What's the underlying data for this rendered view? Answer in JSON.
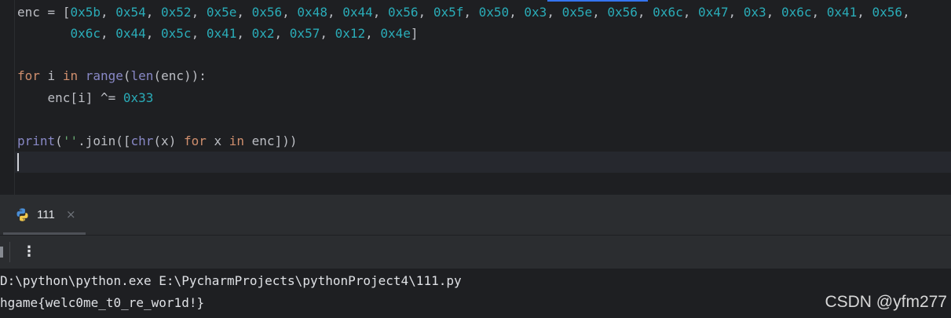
{
  "editor": {
    "lines": [
      [
        {
          "t": "enc = [",
          "c": "ident"
        },
        {
          "t": "0x5b",
          "c": "num"
        },
        {
          "t": ", ",
          "c": "ident"
        },
        {
          "t": "0x54",
          "c": "num"
        },
        {
          "t": ", ",
          "c": "ident"
        },
        {
          "t": "0x52",
          "c": "num"
        },
        {
          "t": ", ",
          "c": "ident"
        },
        {
          "t": "0x5e",
          "c": "num"
        },
        {
          "t": ", ",
          "c": "ident"
        },
        {
          "t": "0x56",
          "c": "num"
        },
        {
          "t": ", ",
          "c": "ident"
        },
        {
          "t": "0x48",
          "c": "num"
        },
        {
          "t": ", ",
          "c": "ident"
        },
        {
          "t": "0x44",
          "c": "num"
        },
        {
          "t": ", ",
          "c": "ident"
        },
        {
          "t": "0x56",
          "c": "num"
        },
        {
          "t": ", ",
          "c": "ident"
        },
        {
          "t": "0x5f",
          "c": "num"
        },
        {
          "t": ", ",
          "c": "ident"
        },
        {
          "t": "0x50",
          "c": "num"
        },
        {
          "t": ", ",
          "c": "ident"
        },
        {
          "t": "0x3",
          "c": "num"
        },
        {
          "t": ", ",
          "c": "ident"
        },
        {
          "t": "0x5e",
          "c": "num"
        },
        {
          "t": ", ",
          "c": "ident"
        },
        {
          "t": "0x56",
          "c": "num"
        },
        {
          "t": ", ",
          "c": "ident"
        },
        {
          "t": "0x6c",
          "c": "num"
        },
        {
          "t": ", ",
          "c": "ident"
        },
        {
          "t": "0x47",
          "c": "num"
        },
        {
          "t": ", ",
          "c": "ident"
        },
        {
          "t": "0x3",
          "c": "num"
        },
        {
          "t": ", ",
          "c": "ident"
        },
        {
          "t": "0x6c",
          "c": "num"
        },
        {
          "t": ", ",
          "c": "ident"
        },
        {
          "t": "0x41",
          "c": "num"
        },
        {
          "t": ", ",
          "c": "ident"
        },
        {
          "t": "0x56",
          "c": "num"
        },
        {
          "t": ",",
          "c": "ident"
        }
      ],
      [
        {
          "t": "       ",
          "c": "ident"
        },
        {
          "t": "0x6c",
          "c": "num"
        },
        {
          "t": ", ",
          "c": "ident"
        },
        {
          "t": "0x44",
          "c": "num"
        },
        {
          "t": ", ",
          "c": "ident"
        },
        {
          "t": "0x5c",
          "c": "num"
        },
        {
          "t": ", ",
          "c": "ident"
        },
        {
          "t": "0x41",
          "c": "num"
        },
        {
          "t": ", ",
          "c": "ident"
        },
        {
          "t": "0x2",
          "c": "num"
        },
        {
          "t": ", ",
          "c": "ident"
        },
        {
          "t": "0x57",
          "c": "num"
        },
        {
          "t": ", ",
          "c": "ident"
        },
        {
          "t": "0x12",
          "c": "num"
        },
        {
          "t": ", ",
          "c": "ident"
        },
        {
          "t": "0x4e",
          "c": "num"
        },
        {
          "t": "]",
          "c": "ident"
        }
      ],
      [
        {
          "t": "for",
          "c": "kw"
        },
        {
          "t": " i ",
          "c": "ident"
        },
        {
          "t": "in",
          "c": "kw"
        },
        {
          "t": " ",
          "c": "ident"
        },
        {
          "t": "range",
          "c": "builtin"
        },
        {
          "t": "(",
          "c": "ident"
        },
        {
          "t": "len",
          "c": "builtin"
        },
        {
          "t": "(enc)):",
          "c": "ident"
        }
      ],
      [
        {
          "t": "    enc[i] ^= ",
          "c": "ident"
        },
        {
          "t": "0x33",
          "c": "num"
        }
      ],
      [
        {
          "t": "print",
          "c": "builtin"
        },
        {
          "t": "(",
          "c": "ident"
        },
        {
          "t": "''",
          "c": "str"
        },
        {
          "t": ".join([",
          "c": "ident"
        },
        {
          "t": "chr",
          "c": "builtin"
        },
        {
          "t": "(x) ",
          "c": "ident"
        },
        {
          "t": "for",
          "c": "kw"
        },
        {
          "t": " x ",
          "c": "ident"
        },
        {
          "t": "in",
          "c": "kw"
        },
        {
          "t": " enc]))",
          "c": "ident"
        }
      ]
    ]
  },
  "run_tab": {
    "label": "111",
    "close_glyph": "×",
    "icon": "python-icon"
  },
  "toolbar": {
    "more_glyph": "⋮"
  },
  "console": {
    "command_line": "D:\\python\\python.exe E:\\PycharmProjects\\pythonProject4\\111.py",
    "output_line": "hgame{welc0me_t0_re_wor1d!}"
  },
  "watermark": "CSDN @yfm277",
  "colors": {
    "background": "#1e1f22",
    "panel": "#2b2d30",
    "number": "#2aacb8",
    "keyword": "#cf8e6d",
    "builtin": "#8888c6",
    "string": "#6aab73",
    "text": "#bcbec4"
  }
}
